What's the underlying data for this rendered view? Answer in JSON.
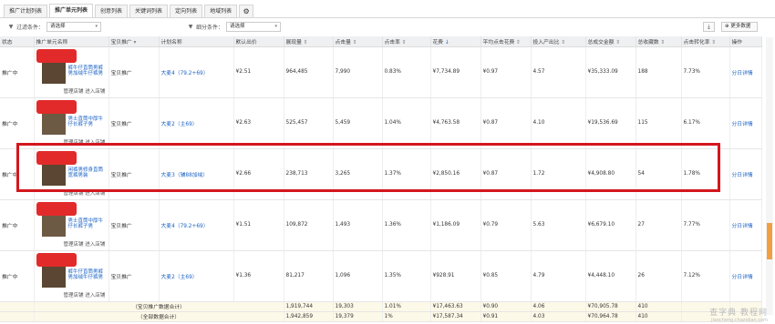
{
  "tabs": [
    {
      "label": "推广计划列表"
    },
    {
      "label": "推广单元列表"
    },
    {
      "label": "创意列表"
    },
    {
      "label": "关键词列表"
    },
    {
      "label": "定向列表"
    },
    {
      "label": "地域列表"
    }
  ],
  "filters": {
    "filter1_label": "过滤条件：",
    "filter1_value": "请选择",
    "filter2_label": "细分条件：",
    "filter2_value": "请选择",
    "more_button": "更多数据"
  },
  "columns": [
    "状态",
    "推广单元名称",
    "宝贝推广",
    "计划名称",
    "默认出价",
    "展现量",
    "点击量",
    "点击率",
    "花费",
    "平均点击花费",
    "投入产出比",
    "总成交金额",
    "总收藏数",
    "点击转化率",
    "操作"
  ],
  "rows": [
    {
      "status": "推广中",
      "title": "裤牛仔直筒男裤男加绒牛仔裤男",
      "links": "管理店铺  进入店铺",
      "type": "宝贝推广",
      "plan": "大麦4（79.2+69）",
      "bid": "¥2.51",
      "impr": "964,485",
      "clicks": "7,990",
      "ctr": "0.83%",
      "cost": "¥7,734.89",
      "cpc": "¥0.97",
      "roi": "4.57",
      "gmv": "¥35,333.09",
      "fav": "188",
      "cvr": "7.73%",
      "op": "分日详情"
    },
    {
      "status": "推广中",
      "title": "男士直筒中厚牛仔长裤子男",
      "links": "管理店铺  进入店铺",
      "type": "宝贝推广",
      "plan": "大麦2（主69）",
      "bid": "¥2.63",
      "impr": "525,457",
      "clicks": "5,459",
      "ctr": "1.04%",
      "cost": "¥4,763.58",
      "cpc": "¥0.87",
      "roi": "4.10",
      "gmv": "¥19,536.69",
      "fav": "115",
      "cvr": "6.17%",
      "op": "分日详情"
    },
    {
      "status": "推广中",
      "title": "闲裤男修身直筒宽裤男装",
      "links": "管理店铺  进入店铺",
      "type": "宝贝推广",
      "plan": "大麦3（辅88加绒）",
      "bid": "¥2.66",
      "impr": "238,713",
      "clicks": "3,265",
      "ctr": "1.37%",
      "cost": "¥2,850.16",
      "cpc": "¥0.87",
      "roi": "1.72",
      "gmv": "¥4,908.80",
      "fav": "54",
      "cvr": "1.78%",
      "op": "分日详情"
    },
    {
      "status": "推广中",
      "title": "男士直筒中厚牛仔长裤子男",
      "links": "管理店铺  进入店铺",
      "type": "宝贝推广",
      "plan": "大麦4（79.2+69）",
      "bid": "¥1.51",
      "impr": "109,872",
      "clicks": "1,493",
      "ctr": "1.36%",
      "cost": "¥1,186.09",
      "cpc": "¥0.79",
      "roi": "5.63",
      "gmv": "¥6,679.10",
      "fav": "27",
      "cvr": "7.77%",
      "op": "分日详情"
    },
    {
      "status": "推广中",
      "title": "裤牛仔直筒男裤男加绒牛仔裤男",
      "links": "管理店铺  进入店铺",
      "type": "宝贝推广",
      "plan": "大麦2（主69）",
      "bid": "¥1.36",
      "impr": "81,217",
      "clicks": "1,096",
      "ctr": "1.35%",
      "cost": "¥928.91",
      "cpc": "¥0.85",
      "roi": "4.79",
      "gmv": "¥4,448.10",
      "fav": "26",
      "cvr": "7.12%",
      "op": "分日详情"
    }
  ],
  "summary": [
    {
      "label": "（宝贝推广数据合计）",
      "impr": "1,919,744",
      "clicks": "19,303",
      "ctr": "1.01%",
      "cost": "¥17,463.63",
      "cpc": "¥0.90",
      "roi": "4.06",
      "gmv": "¥70,905.78",
      "fav": "410"
    },
    {
      "label": "（全部数据合计）",
      "impr": "1,942,859",
      "clicks": "19,379",
      "ctr": "1%",
      "cost": "¥17,587.34",
      "cpc": "¥0.91",
      "roi": "4.03",
      "gmv": "¥70,964.78",
      "fav": "410"
    }
  ],
  "watermark": {
    "main": "查字典 教程网",
    "sub": "jiaocheng.chazidian.com"
  }
}
